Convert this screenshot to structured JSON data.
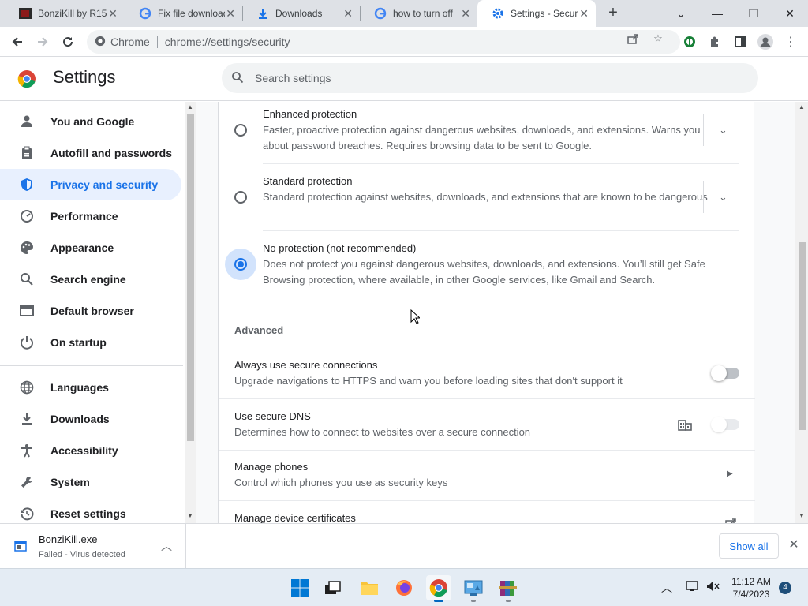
{
  "browser": {
    "tabs": [
      {
        "title": "BonziKill by R15",
        "icon": "bonzi-favicon"
      },
      {
        "title": "Fix file download",
        "icon": "google-favicon"
      },
      {
        "title": "Downloads",
        "icon": "download-favicon"
      },
      {
        "title": "how to turn off",
        "icon": "google-favicon"
      },
      {
        "title": "Settings - Secur",
        "icon": "settings-gear-favicon",
        "active": true
      }
    ],
    "omnibox": {
      "chip": "Chrome",
      "url": "chrome://settings/security"
    }
  },
  "settings": {
    "title": "Settings",
    "search_placeholder": "Search settings",
    "nav": [
      {
        "label": "You and Google",
        "icon": "person-icon"
      },
      {
        "label": "Autofill and passwords",
        "icon": "clipboard-icon"
      },
      {
        "label": "Privacy and security",
        "icon": "shield-icon",
        "selected": true
      },
      {
        "label": "Performance",
        "icon": "speedometer-icon"
      },
      {
        "label": "Appearance",
        "icon": "palette-icon"
      },
      {
        "label": "Search engine",
        "icon": "search-icon"
      },
      {
        "label": "Default browser",
        "icon": "browser-window-icon"
      },
      {
        "label": "On startup",
        "icon": "power-icon"
      },
      {
        "label": "Languages",
        "icon": "globe-icon"
      },
      {
        "label": "Downloads",
        "icon": "download-icon"
      },
      {
        "label": "Accessibility",
        "icon": "accessibility-icon"
      },
      {
        "label": "System",
        "icon": "wrench-icon"
      },
      {
        "label": "Reset settings",
        "icon": "reset-icon"
      }
    ],
    "protection": [
      {
        "title": "Enhanced protection",
        "desc": "Faster, proactive protection against dangerous websites, downloads, and extensions. Warns you about password breaches. Requires browsing data to be sent to Google.",
        "checked": false
      },
      {
        "title": "Standard protection",
        "desc": "Standard protection against websites, downloads, and extensions that are known to be dangerous",
        "checked": false
      },
      {
        "title": "No protection (not recommended)",
        "desc": "Does not protect you against dangerous websites, downloads, and extensions. You’ll still get Safe Browsing protection, where available, in other Google services, like Gmail and Search.",
        "checked": true
      }
    ],
    "advanced": {
      "heading": "Advanced",
      "https": {
        "title": "Always use secure connections",
        "desc": "Upgrade navigations to HTTPS and warn you before loading sites that don't support it",
        "on": false
      },
      "dns": {
        "title": "Use secure DNS",
        "desc": "Determines how to connect to websites over a secure connection",
        "on": false,
        "managed_icon": "enterprise-building-icon"
      },
      "phones": {
        "title": "Manage phones",
        "desc": "Control which phones you use as security keys"
      },
      "certs": {
        "title": "Manage device certificates"
      }
    }
  },
  "download_shelf": {
    "file": "BonziKill.exe",
    "status": "Failed - Virus detected",
    "show_all": "Show all"
  },
  "taskbar": {
    "time": "11:12 AM",
    "date": "7/4/2023",
    "notifications": "4"
  },
  "colors": {
    "accent": "#1a73e8",
    "selected_bg": "#e8f0fe"
  }
}
